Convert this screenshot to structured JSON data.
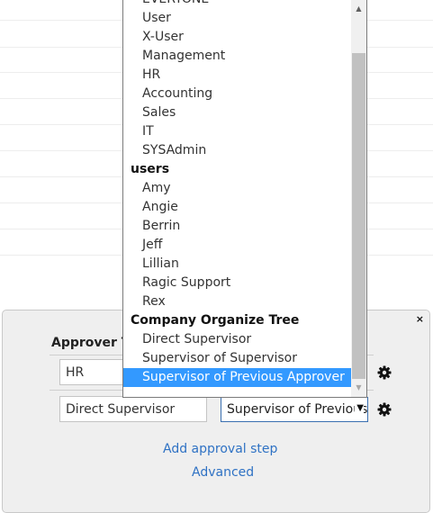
{
  "dropdown": {
    "sections": [
      {
        "type": "option",
        "label": "EVERYONE"
      },
      {
        "type": "option",
        "label": "User"
      },
      {
        "type": "option",
        "label": "X-User"
      },
      {
        "type": "option",
        "label": "Management"
      },
      {
        "type": "option",
        "label": "HR"
      },
      {
        "type": "option",
        "label": "Accounting"
      },
      {
        "type": "option",
        "label": "Sales"
      },
      {
        "type": "option",
        "label": "IT"
      },
      {
        "type": "option",
        "label": "SYSAdmin"
      },
      {
        "type": "group",
        "label": "users"
      },
      {
        "type": "option",
        "label": "Amy"
      },
      {
        "type": "option",
        "label": "Angie"
      },
      {
        "type": "option",
        "label": "Berrin"
      },
      {
        "type": "option",
        "label": "Jeff"
      },
      {
        "type": "option",
        "label": "Lillian"
      },
      {
        "type": "option",
        "label": "Ragic Support"
      },
      {
        "type": "option",
        "label": "Rex"
      },
      {
        "type": "group",
        "label": "Company Organize Tree"
      },
      {
        "type": "option",
        "label": "Direct Supervisor"
      },
      {
        "type": "option",
        "label": "Supervisor of Supervisor"
      },
      {
        "type": "option",
        "label": "Supervisor of Previous Approver",
        "selected": true
      }
    ],
    "selected_color": "#3399ff"
  },
  "panel": {
    "close_label": "×",
    "approver_type_label": "Approver T",
    "rows": [
      {
        "value": "HR"
      },
      {
        "value": "Direct Supervisor",
        "select_value": "Supervisor of Previous Approver"
      }
    ],
    "add_step_link": "Add approval step",
    "advanced_link": "Advanced",
    "link_color": "#2f72c4"
  }
}
